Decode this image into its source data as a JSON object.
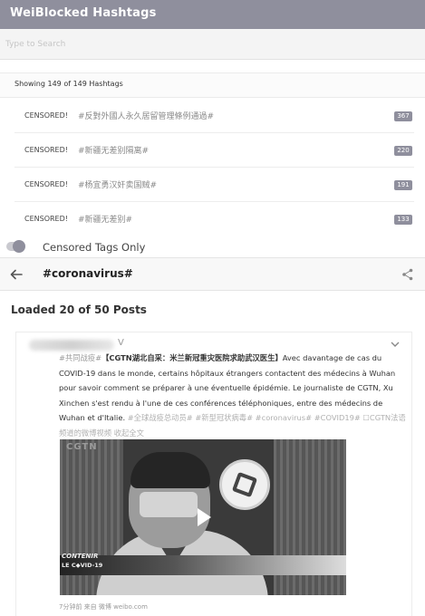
{
  "app": {
    "title": "WeiBlocked Hashtags"
  },
  "search": {
    "placeholder": "Type to Search"
  },
  "summary": {
    "showing": "Showing 149 of 149 Hashtags"
  },
  "tags": [
    {
      "status": "CENSORED!",
      "name": "#反對外國人永久居留管理條例通過#",
      "count": "367"
    },
    {
      "status": "CENSORED!",
      "name": "#新疆无差别隔离#",
      "count": "220"
    },
    {
      "status": "CENSORED!",
      "name": "#杨宜勇汉奸卖国贼#",
      "count": "191"
    },
    {
      "status": "CENSORED!",
      "name": "#新疆无差别#",
      "count": "133"
    }
  ],
  "toggle": {
    "label": "Censored Tags Only",
    "on": true
  },
  "feed": {
    "hashtag": "#coronavirus#",
    "loaded": "Loaded 20 of 50 Posts"
  },
  "post": {
    "verified": "V",
    "prefix_tag": "#共同战疫#",
    "headline": "【CGTN湖北自采：米兰新冠重灾医院求助武汉医生】",
    "text": "Avec davantage de cas du COVID-19 dans le monde, certains hôpitaux étrangers contactent des médecins à Wuhan pour savoir comment se préparer à une éventuelle épidémie. Le journaliste de CGTN, Xu Xinchen s'est rendu à l'une de ces conférences téléphoniques, entre des médecins de Wuhan et d'Italie.",
    "tags_line": "#全球战疫总动员# #新型冠状病毒# #coronavirus# #COVID19# ☐CGTN法语频道的微博视频 收起全文",
    "video": {
      "channel": "CGTN",
      "lower_line1": "CONTENIR",
      "lower_line2": "LE C◆VID-19"
    },
    "footer": "7分钟前  来自 微博 weibo.com"
  },
  "colors": {
    "accent": "#8f8f9d",
    "badge": "#8f8f9d"
  },
  "icons": [
    "back-arrow-icon",
    "share-icon",
    "chevron-down-icon",
    "play-icon"
  ]
}
